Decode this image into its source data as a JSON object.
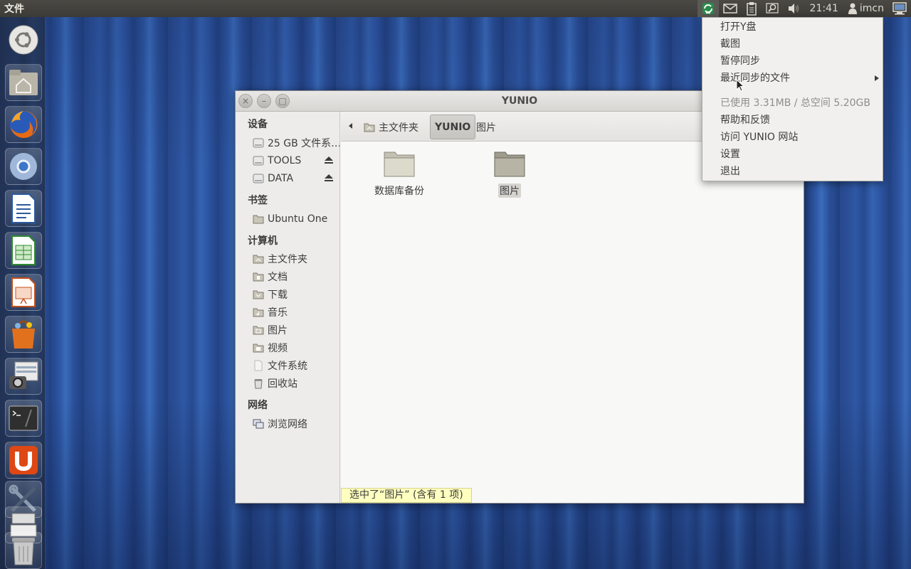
{
  "top_panel": {
    "app_title": "文件",
    "clock": "21:41",
    "user": "imcn"
  },
  "indicators": [
    "yunio-sync-icon",
    "mail-icon",
    "clipboard-icon",
    "search-icon",
    "volume-icon",
    "user-icon",
    "system-icon"
  ],
  "launcher": {
    "items": [
      "dash-home",
      "home-folder",
      "firefox",
      "chromium",
      "writer",
      "calc",
      "impress",
      "software-center",
      "screenshot",
      "terminal",
      "ubuntu-one",
      "system-settings",
      "workspaces",
      "trash"
    ]
  },
  "window": {
    "title": "YUNIO",
    "buttons": {
      "close": "×",
      "minimize": "–",
      "maximize": "□"
    },
    "sidebar": {
      "devices_heading": "设备",
      "devices": [
        {
          "label": "25 GB 文件系…",
          "eject": false
        },
        {
          "label": "TOOLS",
          "eject": true
        },
        {
          "label": "DATA",
          "eject": true
        }
      ],
      "bookmarks_heading": "书签",
      "bookmarks": [
        {
          "label": "Ubuntu One"
        }
      ],
      "computer_heading": "计算机",
      "computer": [
        {
          "label": "主文件夹"
        },
        {
          "label": "文档"
        },
        {
          "label": "下载"
        },
        {
          "label": "音乐"
        },
        {
          "label": "图片"
        },
        {
          "label": "视频"
        },
        {
          "label": "文件系统"
        },
        {
          "label": "回收站"
        }
      ],
      "network_heading": "网络",
      "network": [
        {
          "label": "浏览网络"
        }
      ]
    },
    "breadcrumb": {
      "home": "主文件夹",
      "current": "YUNIO",
      "next": "图片"
    },
    "folders": [
      {
        "label": "数据库备份",
        "selected": false
      },
      {
        "label": "图片",
        "selected": true
      }
    ],
    "status": "选中了“图片” (含有 1 项)"
  },
  "tray_menu": {
    "items": [
      {
        "label": "打开Y盘",
        "enabled": true
      },
      {
        "label": "截图",
        "enabled": true
      },
      {
        "label": "暂停同步",
        "enabled": true
      },
      {
        "label": "最近同步的文件",
        "enabled": true,
        "submenu": true
      },
      {
        "label": "已使用 3.31MB / 总空间 5.20GB",
        "enabled": false
      },
      {
        "label": "帮助和反馈",
        "enabled": true
      },
      {
        "label": "访问 YUNIO 网站",
        "enabled": true
      },
      {
        "label": "设置",
        "enabled": true
      },
      {
        "label": "退出",
        "enabled": true
      }
    ]
  },
  "colors": {
    "panel": "#3c3b37",
    "window_bg": "#f2f1f0",
    "status_bg": "#ffffbf",
    "wallpaper": "#2a4a8a"
  }
}
